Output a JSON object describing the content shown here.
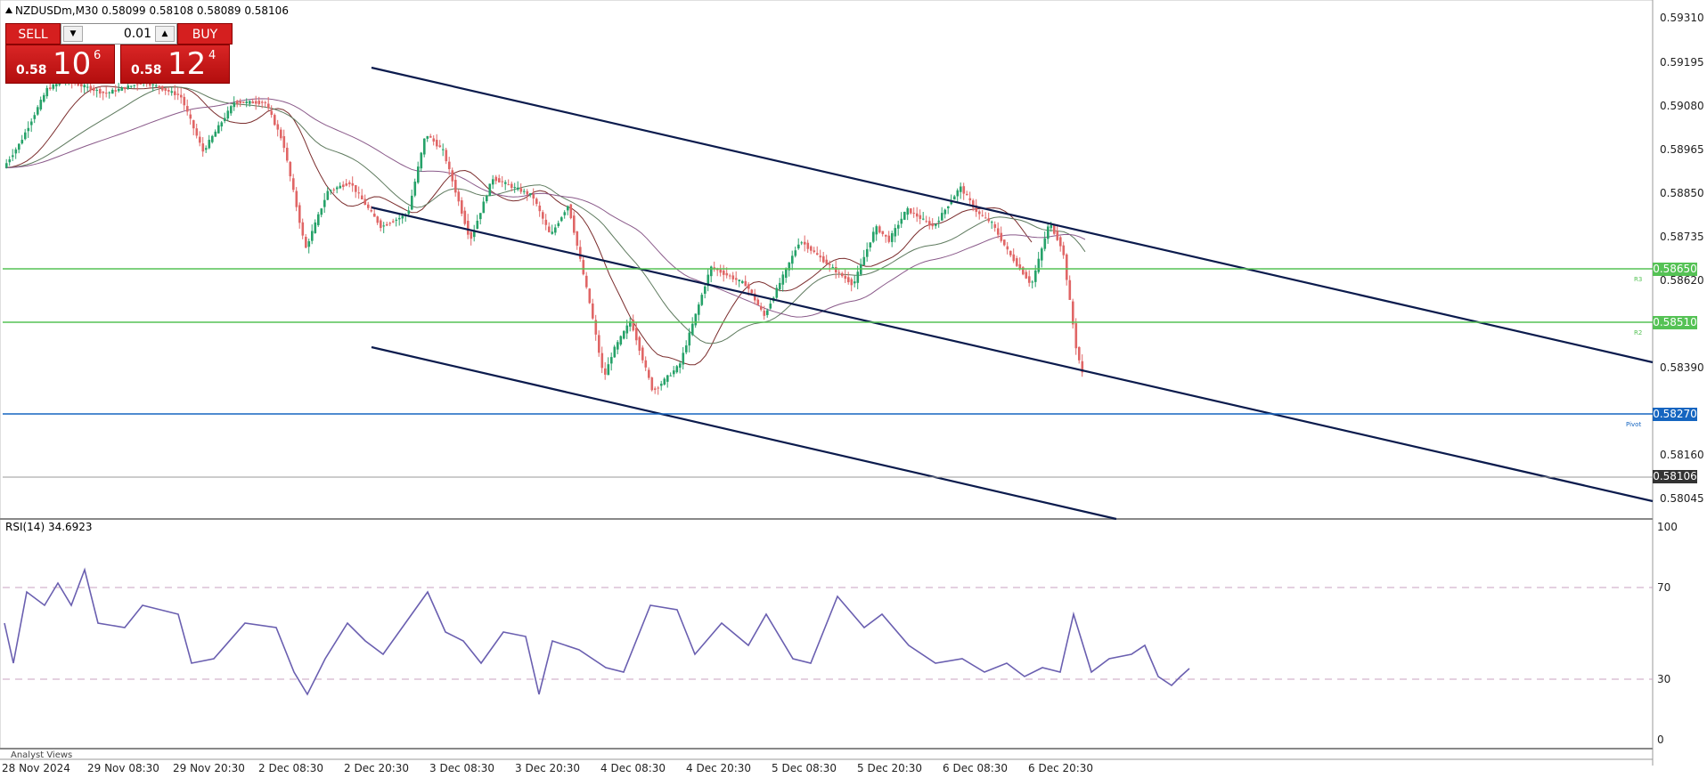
{
  "symbol_title": "NZDUSDm,M30  0.58099 0.58108 0.58089 0.58106",
  "one_click": {
    "sell_label": "SELL",
    "buy_label": "BUY",
    "lot": "0.01",
    "sell_quote": {
      "small": "0.58",
      "big": "10",
      "sup": "6"
    },
    "buy_quote": {
      "small": "0.58",
      "big": "12",
      "sup": "4"
    }
  },
  "price_axis": [
    "0.59310",
    "0.59195",
    "0.59080",
    "0.58965",
    "0.58850",
    "0.58735",
    "0.58620",
    "0.58390",
    "0.58160",
    "0.58045"
  ],
  "levels": [
    {
      "name": "R3",
      "value": "0.58650",
      "color": "#55c255"
    },
    {
      "name": "R2",
      "value": "0.58510",
      "color": "#55c255"
    },
    {
      "name": "Pivot",
      "value": "0.58270",
      "color": "#1565c0"
    }
  ],
  "current_price": "0.58106",
  "rsi": {
    "title": "RSI(14) 34.6923",
    "levels": [
      "100",
      "70",
      "30",
      "0"
    ]
  },
  "time_axis": [
    "28 Nov 2024",
    "29 Nov 08:30",
    "29 Nov 20:30",
    "2 Dec 08:30",
    "2 Dec 20:30",
    "3 Dec 08:30",
    "3 Dec 20:30",
    "4 Dec 08:30",
    "4 Dec 20:30",
    "5 Dec 08:30",
    "5 Dec 20:30",
    "6 Dec 08:30",
    "6 Dec 20:30"
  ],
  "analyst_label": "Analyst Views",
  "colors": {
    "bull": "#26a269",
    "bear": "#e06666",
    "rsi_line": "#6a5fb0"
  }
}
